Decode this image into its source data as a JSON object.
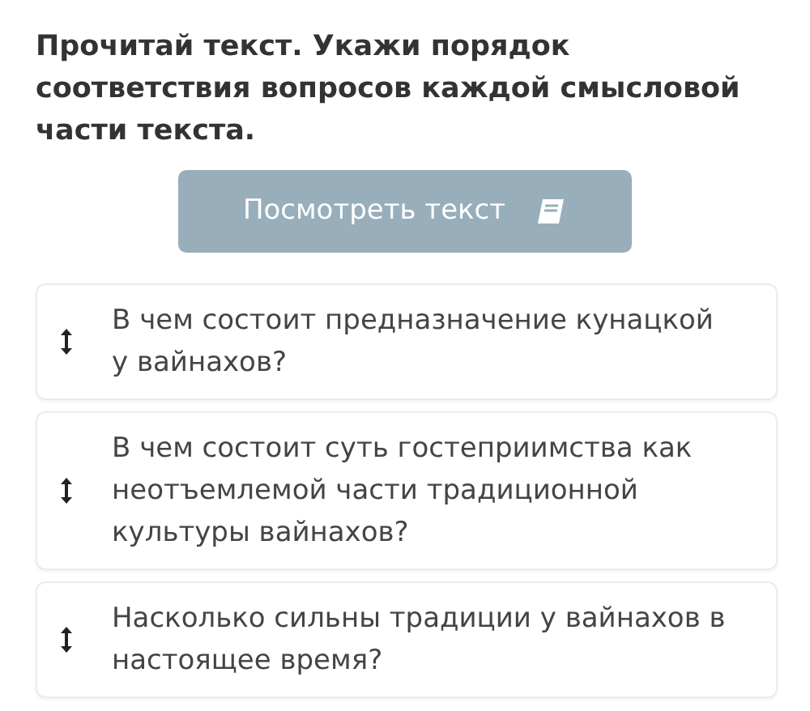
{
  "instruction": "Прочитай текст. Укажи порядок соответствия вопросов каждой смысловой части текста.",
  "view_text_button": {
    "label": "Посмотреть текст"
  },
  "questions": [
    {
      "text": "В чем состоит предназначение кунацкой у вайнахов?"
    },
    {
      "text": "В чем состоит суть гостеприимства как неотъемлемой части традиционной культуры вайнахов?"
    },
    {
      "text": "Насколько сильны традиции у вайнахов в настоящее время?"
    }
  ]
}
